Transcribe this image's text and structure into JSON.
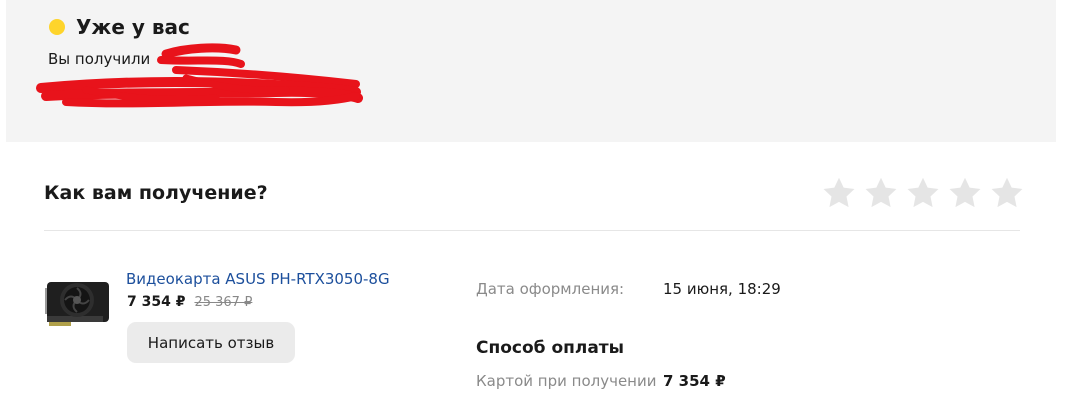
{
  "status": {
    "title": "Уже у вас",
    "text": "Вы получили",
    "dot_color": "#fed42b"
  },
  "rating": {
    "question": "Как вам получение?",
    "stars_total": 5,
    "stars_selected": 0
  },
  "product": {
    "name": "Видеокарта ASUS PH-RTX3050-8G",
    "price": "7 354 ₽",
    "old_price": "25 367 ₽",
    "image_icon": "graphics-card-icon",
    "review_button": "Написать отзыв"
  },
  "order": {
    "date_label": "Дата оформления:",
    "date_value": "15 июня, 18:29"
  },
  "payment": {
    "title": "Способ оплаты",
    "method": "Картой при получении",
    "amount": "7 354 ₽"
  },
  "colors": {
    "link": "#1c4f9c",
    "star_empty": "#e5e5e5",
    "redaction": "#e8131b"
  }
}
